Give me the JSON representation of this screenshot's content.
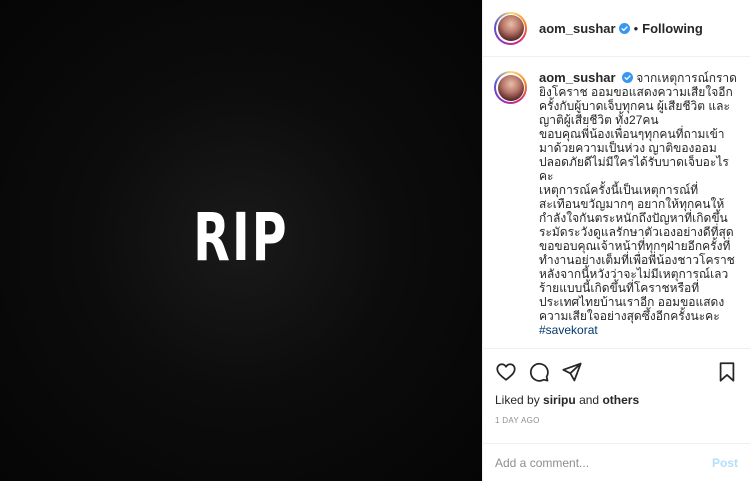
{
  "media": {
    "text": "RIP"
  },
  "header": {
    "username": "aom_sushar",
    "separator": "•",
    "follow_state": "Following"
  },
  "caption": {
    "username": "aom_sushar",
    "text": "จากเหตุการณ์กราดยิงโคราช ออมขอแสดงความเสียใจอีกครั้งกับผู้บาดเจ็บทุกคน ผู้เสียชีวิต และ ญาติผู้เสียชีวิต ทั้ง27คน\nขอบคุณพี่น้องเพื่อนๆทุกคนที่ถามเข้ามาด้วยความเป็นห่วง ญาติของออมปลอดภัยดีไม่มีใครได้รับบาดเจ็บอะไรคะ\nเหตุการณ์ครั้งนี้เป็นเหตุการณ์ที่สะเทือนขวัญมากๆ อยากให้ทุกคนให้กำลังใจกันตระหนักถึงปัญหาที่เกิดขึ้น ระมัดระวังดูแลรักษาตัวเองอย่างดีที่สุด\nขอขอบคุณเจ้าหน้าที่ทุกๆฝ่ายอีกครั้งที่ทำงานอย่างเต็มที่เพื่อพี่น้องชาวโคราช\nหลังจากนี้หวังว่าจะไม่มีเหตุการณ์เลวร้ายแบบนี้เกิดขึ้นที่โคราชหรือที่ประเทศไทยบ้านเราอีก ออมขอแสดงความเสียใจอย่างสุดซึ้งอีกครั้งนะคะ",
    "hashtag": "#savekorat",
    "time_ago": "1d"
  },
  "icons": {
    "like": "heart-icon",
    "comment": "comment-icon",
    "share": "share-icon",
    "save": "bookmark-icon",
    "verified": "verified-badge-icon",
    "verified_color": "#3897f0"
  },
  "likes": {
    "prefix": "Liked by",
    "user": "siripu",
    "conj": "and",
    "others": "others"
  },
  "date": "1 DAY AGO",
  "add_comment": {
    "placeholder": "Add a comment...",
    "post_label": "Post"
  }
}
